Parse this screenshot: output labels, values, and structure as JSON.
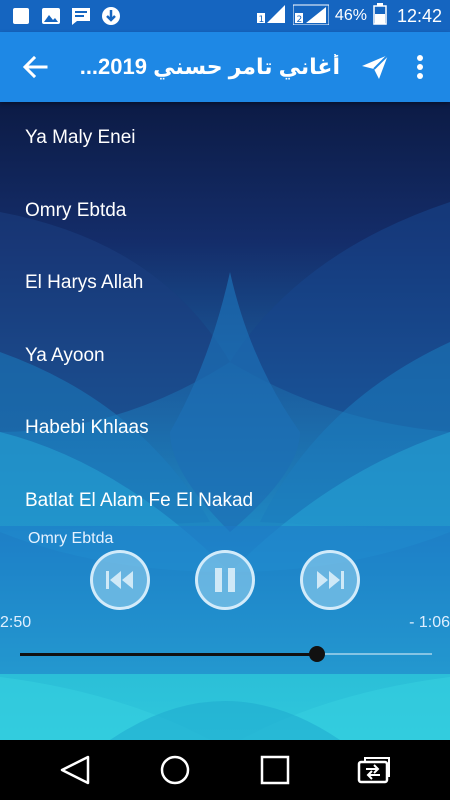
{
  "status_bar": {
    "battery_percent": "46%",
    "time": "12:42",
    "icons": [
      "stop-icon",
      "image-icon",
      "message-icon",
      "download-icon",
      "sim1-signal-icon",
      "sim2-signal-icon",
      "battery-icon"
    ]
  },
  "app_bar": {
    "title": "أغاني تامر حسني 2019...",
    "back_icon": "arrow-back-icon",
    "send_icon": "send-icon",
    "more_icon": "more-vert-icon"
  },
  "songs": [
    {
      "title": "Ya Maly Enei"
    },
    {
      "title": "Omry Ebtda"
    },
    {
      "title": "El Harys Allah"
    },
    {
      "title": "Ya Ayoon"
    },
    {
      "title": "Habebi Khlaas"
    },
    {
      "title": "Batlat El Alam Fe El Nakad"
    }
  ],
  "player": {
    "now_playing": "Omry Ebtda",
    "elapsed": "2:50",
    "remaining": "- 1:06",
    "progress_fraction": 0.72,
    "controls": [
      "rewind-icon",
      "pause-icon",
      "fast-forward-icon"
    ]
  },
  "nav_bar": {
    "buttons": [
      "back-triangle-icon",
      "home-circle-icon",
      "recents-square-icon",
      "switch-app-icon"
    ]
  },
  "colors": {
    "status_bar": "#1565c0",
    "app_bar": "#1e88e5",
    "bg_dark": "#0d1f4f",
    "bg_light": "#2ec6d8"
  }
}
